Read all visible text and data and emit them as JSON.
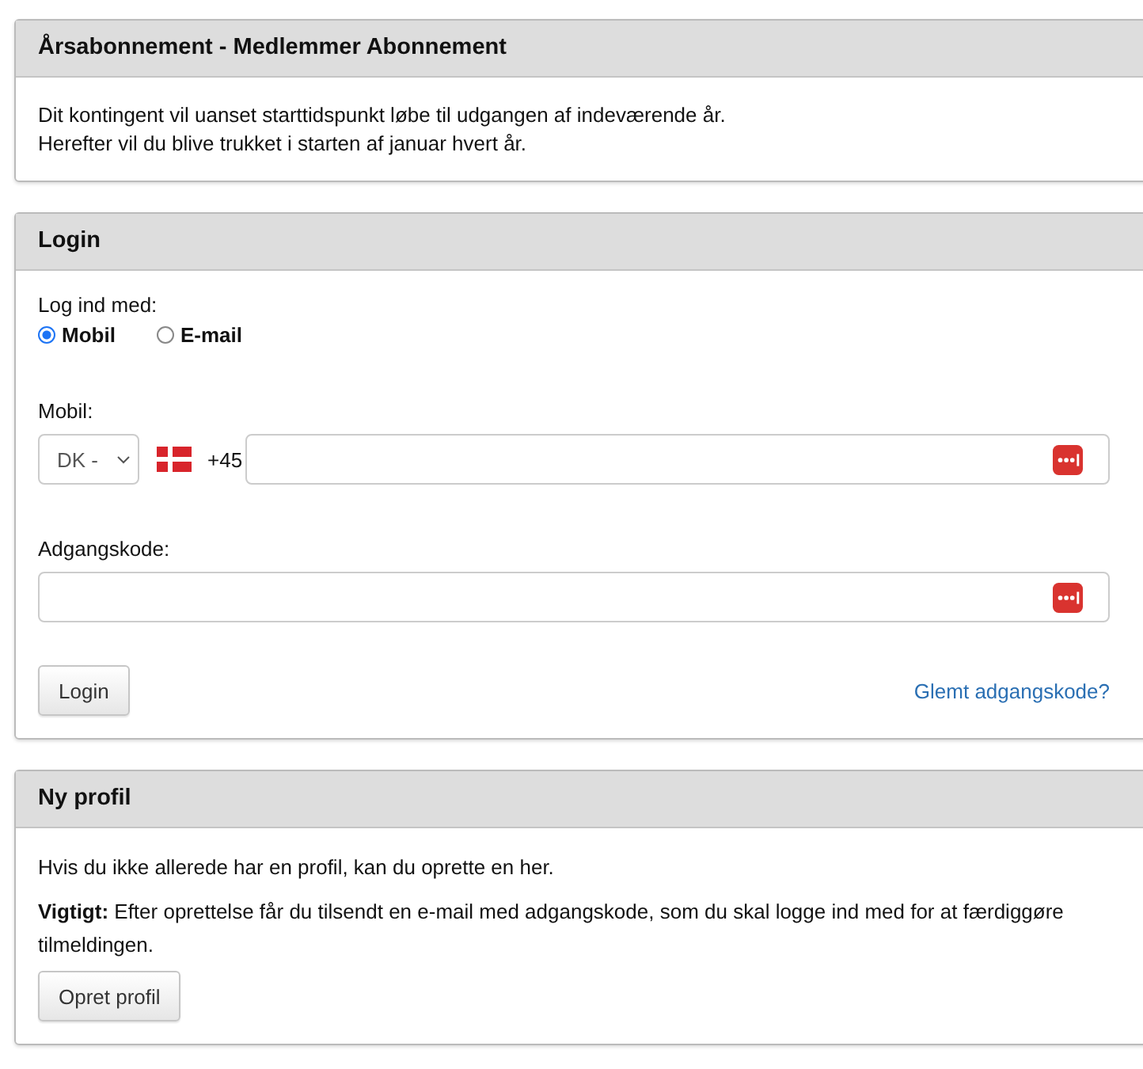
{
  "panels": [
    {
      "kind": "info",
      "title": "Årsabonnement - Medlemmer Abonnement",
      "paragraphs": [
        "Dit kontingent vil uanset starttidspunkt løbe til udgangen af indeværende år.",
        "Herefter vil du blive trukket i starten af januar hvert år."
      ]
    },
    {
      "kind": "login",
      "title": "Login",
      "method_label": "Log ind med:",
      "methods": [
        {
          "label": "Mobil",
          "selected": true
        },
        {
          "label": "E-mail",
          "selected": false
        }
      ],
      "mobile_label": "Mobil:",
      "country": "DK -",
      "dial_code": "+45",
      "password_label": "Adgangskode:",
      "button": "Login",
      "forgot_link": "Glemt adgangskode?"
    },
    {
      "kind": "signup",
      "title": "Ny profil",
      "paragraphs": [
        "Hvis du ikke allerede har en profil, kan du oprette en her.",
        "**Vigtigt:** Efter oprettelse får du tilsendt en e-mail med adgangskode, som du skal logge ind med for at færdiggøre tilmeldingen."
      ],
      "button": "Opret profil"
    }
  ]
}
